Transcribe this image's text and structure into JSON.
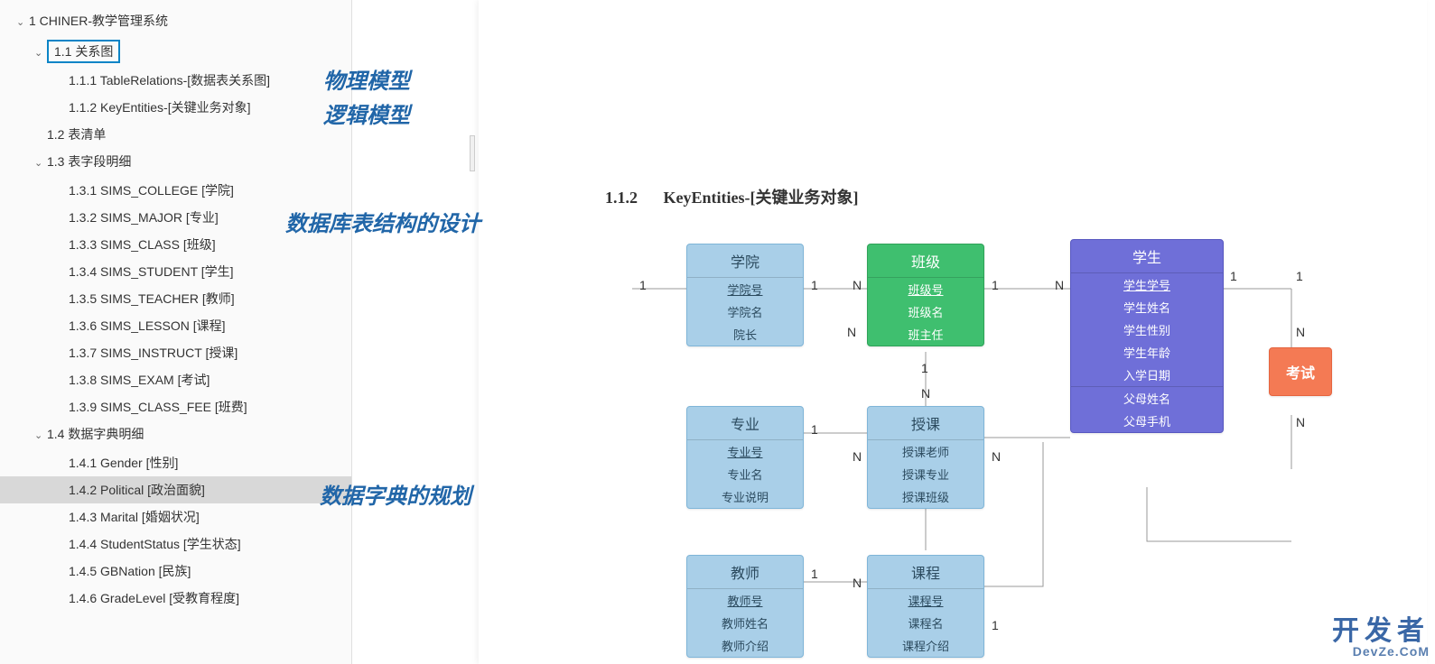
{
  "tree": {
    "root": "1  CHINER-教学管理系统",
    "n11": "1.1  关系图",
    "n111": "1.1.1  TableRelations-[数据表关系图]",
    "n112": "1.1.2  KeyEntities-[关键业务对象]",
    "n12": "1.2  表清单",
    "n13": "1.3  表字段明细",
    "n131": "1.3.1  SIMS_COLLEGE [学院]",
    "n132": "1.3.2  SIMS_MAJOR [专业]",
    "n133": "1.3.3  SIMS_CLASS [班级]",
    "n134": "1.3.4  SIMS_STUDENT [学生]",
    "n135": "1.3.5  SIMS_TEACHER [教师]",
    "n136": "1.3.6  SIMS_LESSON [课程]",
    "n137": "1.3.7  SIMS_INSTRUCT [授课]",
    "n138": "1.3.8  SIMS_EXAM [考试]",
    "n139": "1.3.9  SIMS_CLASS_FEE [班费]",
    "n14": "1.4  数据字典明细",
    "n141": "1.4.1  Gender [性别]",
    "n142": "1.4.2  Political [政治面貌]",
    "n143": "1.4.3  Marital [婚姻状况]",
    "n144": "1.4.4  StudentStatus [学生状态]",
    "n145": "1.4.5  GBNation [民族]",
    "n146": "1.4.6  GradeLevel [受教育程度]"
  },
  "annotations": {
    "a1": "物理模型",
    "a2": "逻辑模型",
    "a3": "数据库表结构的设计",
    "a4": "数据字典的规划"
  },
  "heading": {
    "num": "1.1.2",
    "title_en": "KeyEntities-",
    "title_cn": "[关键业务对象]"
  },
  "entities": {
    "college": {
      "name": "学院",
      "rows": [
        "学院号",
        "学院名",
        "院长"
      ]
    },
    "class": {
      "name": "班级",
      "rows": [
        "班级号",
        "班级名",
        "班主任"
      ]
    },
    "student": {
      "name": "学生",
      "rows": [
        "学生学号",
        "学生姓名",
        "学生性别",
        "学生年龄",
        "入学日期"
      ],
      "extra": [
        "父母姓名",
        "父母手机"
      ]
    },
    "major": {
      "name": "专业",
      "rows": [
        "专业号",
        "专业名",
        "专业说明"
      ]
    },
    "instruct": {
      "name": "授课",
      "rows": [
        "授课老师",
        "授课专业",
        "授课班级"
      ]
    },
    "teacher": {
      "name": "教师",
      "rows": [
        "教师号",
        "教师姓名",
        "教师介绍"
      ]
    },
    "lesson": {
      "name": "课程",
      "rows": [
        "课程号",
        "课程名",
        "课程介绍"
      ]
    },
    "exam": {
      "name": "考试"
    }
  },
  "cardinality": {
    "c1": "1",
    "c2": "1",
    "c3": "N",
    "c4": "1",
    "c5": "N",
    "c6": "1",
    "c7": "N",
    "c8": "1",
    "c9": "N",
    "c10": "1",
    "c11": "N",
    "c12": "N",
    "c13": "N",
    "c14": "1",
    "c15": "1",
    "c16": "1",
    "c17": "N",
    "c18": "N"
  },
  "watermark": {
    "line1": "开发者",
    "url": "DevZe.CoM"
  }
}
